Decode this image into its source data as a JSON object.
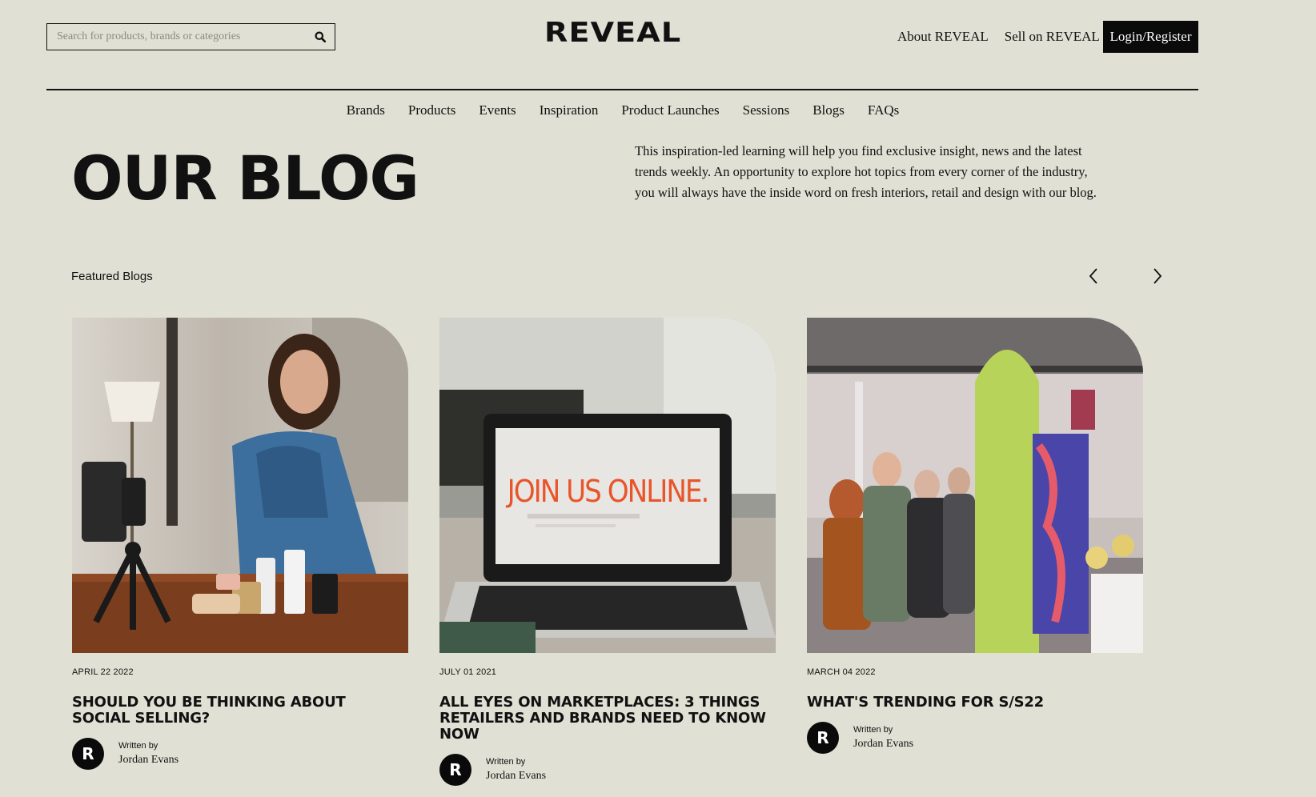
{
  "header": {
    "search_placeholder": "Search for products, brands or categories",
    "logo": "REVEAL",
    "links": [
      "About REVEAL",
      "Sell on REVEAL"
    ],
    "login_label": "Login/Register"
  },
  "nav": {
    "items": [
      "Brands",
      "Products",
      "Events",
      "Inspiration",
      "Product Launches",
      "Sessions",
      "Blogs",
      "FAQs"
    ]
  },
  "hero": {
    "title": "OUR BLOG",
    "intro": "This inspiration-led learning will help you find exclusive insight, news and the latest trends weekly. An opportunity to explore hot topics from every corner of the industry, you will always have the inside word on fresh interiors, retail and design with our blog."
  },
  "featured": {
    "label": "Featured Blogs",
    "cards": [
      {
        "date": "APRIL 22 2022",
        "title": "SHOULD YOU BE THINKING ABOUT SOCIAL SELLING?",
        "written_by": "Written by",
        "author": "Jordan Evans",
        "avatar_letter": "R"
      },
      {
        "date": "JULY 01 2021",
        "title": "ALL EYES ON MARKETPLACES: 3 THINGS RETAILERS AND BRANDS NEED TO KNOW NOW",
        "written_by": "Written by",
        "author": "Jordan Evans",
        "avatar_letter": "R",
        "screen_text": "JOIN US ONLINE."
      },
      {
        "date": "MARCH 04 2022",
        "title": "WHAT'S TRENDING FOR S/S22",
        "written_by": "Written by",
        "author": "Jordan Evans",
        "avatar_letter": "R"
      }
    ]
  }
}
